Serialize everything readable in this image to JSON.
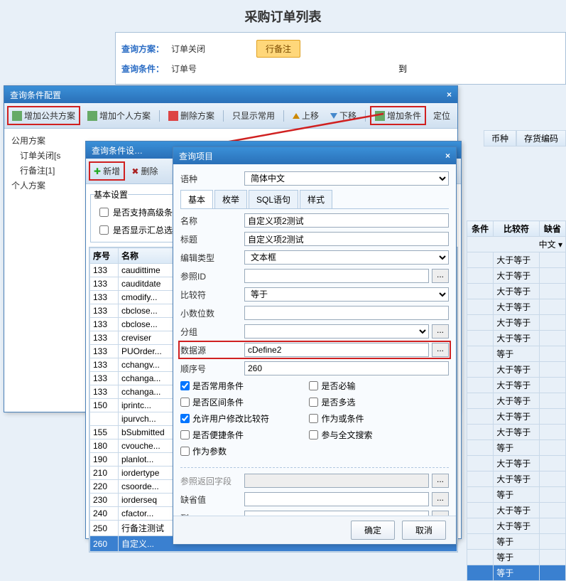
{
  "pageTitle": "采购订单列表",
  "topForm": {
    "schemeLabel": "查询方案：",
    "schemeVal": "订单关闭",
    "tagBtn": "行备注",
    "condLabel": "查询条件：",
    "condVal": "订单号",
    "toLabel": "到"
  },
  "win1": {
    "title": "查询条件配置",
    "tb": {
      "addPublic": "增加公共方案",
      "addPersonal": "增加个人方案",
      "delScheme": "删除方案",
      "showCommon": "只显示常用",
      "moveUp": "上移",
      "moveDown": "下移",
      "addCond": "增加条件",
      "locate": "定位"
    },
    "tree": {
      "public": "公用方案",
      "n1": "订单关闭[s",
      "n2": "行备注[1]",
      "personal": "个人方案"
    }
  },
  "rightHead": {
    "c1": "币种",
    "c2": "存货编码"
  },
  "win2": {
    "title": "查询条件设…",
    "tb": {
      "add": "新增",
      "del": "删除"
    },
    "chk1": "是否支持高级条件",
    "chk2": "是否显示汇总选择",
    "cols": {
      "no": "序号",
      "name": "名称"
    },
    "rows": [
      {
        "no": "133",
        "name": "caudittime"
      },
      {
        "no": "133",
        "name": "cauditdate"
      },
      {
        "no": "133",
        "name": "cmodify..."
      },
      {
        "no": "133",
        "name": "cbclose..."
      },
      {
        "no": "133",
        "name": "cbclose..."
      },
      {
        "no": "133",
        "name": "creviser"
      },
      {
        "no": "133",
        "name": "PUOrder..."
      },
      {
        "no": "133",
        "name": "cchangv..."
      },
      {
        "no": "133",
        "name": "cchanga..."
      },
      {
        "no": "133",
        "name": "cchanga..."
      },
      {
        "no": "150",
        "name": "iprintc..."
      },
      {
        "no": "",
        "name": "ipurvch..."
      },
      {
        "no": "155",
        "name": "bSubmitted"
      },
      {
        "no": "180",
        "name": "cvouche..."
      },
      {
        "no": "190",
        "name": "planlot..."
      },
      {
        "no": "210",
        "name": "iordertype"
      },
      {
        "no": "220",
        "name": "csoorde..."
      },
      {
        "no": "230",
        "name": "iorderseq"
      },
      {
        "no": "240",
        "name": "cfactor..."
      },
      {
        "no": "250",
        "name": "行备注测试"
      },
      {
        "no": "260",
        "name": "自定义..."
      }
    ]
  },
  "win3": {
    "title": "查询项目",
    "langLabel": "语种",
    "langVal": "简体中文",
    "tabs": {
      "t1": "基本",
      "t2": "枚举",
      "t3": "SQL语句",
      "t4": "样式"
    },
    "f": {
      "name": {
        "l": "名称",
        "v": "自定义项2测试"
      },
      "title": {
        "l": "标题",
        "v": "自定义项2测试"
      },
      "editType": {
        "l": "编辑类型",
        "v": "文本框"
      },
      "refId": {
        "l": "参照ID",
        "v": ""
      },
      "compare": {
        "l": "比较符",
        "v": "等于"
      },
      "decimals": {
        "l": "小数位数",
        "v": ""
      },
      "group": {
        "l": "分组",
        "v": ""
      },
      "source": {
        "l": "数据源",
        "v": "cDefine2"
      },
      "order": {
        "l": "顺序号",
        "v": "260"
      }
    },
    "cks": {
      "common": "是否常用条件",
      "required": "是否必输",
      "range": "是否区间条件",
      "multi": "是否多选",
      "allowMod": "允许用户修改比较符",
      "asOr": "作为或条件",
      "shortcut": "是否便捷条件",
      "fulltext": "参与全文搜索",
      "asParam": "作为参数"
    },
    "retField": "参照返回字段",
    "defVal": "缺省值",
    "toLabel": "到",
    "ok": "确定",
    "cancel": "取消"
  },
  "rightGrid": {
    "hdr": {
      "cond": "条件",
      "cmp": "比较符",
      "miss": "缺省"
    },
    "langVal": "中文",
    "cmps": [
      "大于等于",
      "大于等于",
      "大于等于",
      "大于等于",
      "大于等于",
      "大于等于",
      "等于",
      "大于等于",
      "大于等于",
      "大于等于",
      "大于等于",
      "大于等于",
      "等于",
      "大于等于",
      "大于等于",
      "等于",
      "大于等于",
      "大于等于",
      "等于",
      "等于",
      "等于"
    ]
  }
}
